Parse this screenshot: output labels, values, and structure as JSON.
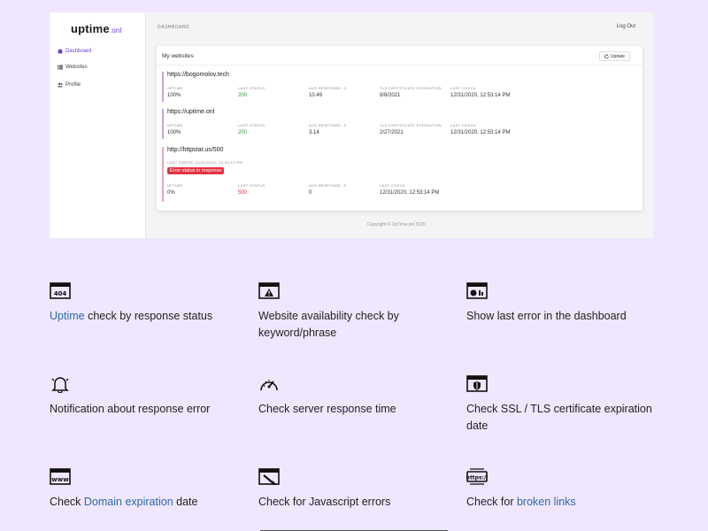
{
  "app": {
    "logo_main": "uptime",
    "logo_tld": ".onl",
    "sidebar": [
      {
        "label": "Dashboard",
        "icon": "dashboard-icon",
        "active": true
      },
      {
        "label": "Websites",
        "icon": "list-icon",
        "active": false
      },
      {
        "label": "Profile",
        "icon": "users-icon",
        "active": false
      }
    ],
    "breadcrumb": "DASHBOARD",
    "logout": "Log Out",
    "card_title": "My websites",
    "update_label": "Update",
    "sites": [
      {
        "url": "https://bogomolov.tech",
        "metrics": [
          {
            "label": "UPTIME",
            "value": "100%"
          },
          {
            "label": "LAST STATUS",
            "value": "200"
          },
          {
            "label": "AVG RESPONSE, S",
            "value": "10.49"
          },
          {
            "label": "TLS CERTIFICATE EXPIRATION",
            "value": "8/8/2021"
          },
          {
            "label": "LAST CHECK",
            "value": "12/31/2020, 12:53:14 PM"
          }
        ]
      },
      {
        "url": "https://uptime.onl",
        "metrics": [
          {
            "label": "UPTIME",
            "value": "100%"
          },
          {
            "label": "LAST STATUS",
            "value": "200"
          },
          {
            "label": "AVG RESPONSE, S",
            "value": "3.14"
          },
          {
            "label": "TLS CERTIFICATE EXPIRATION",
            "value": "2/27/2021"
          },
          {
            "label": "LAST CHECK",
            "value": "12/31/2020, 12:53:14 PM"
          }
        ]
      },
      {
        "url": "http://httpstat.us/500",
        "last_error_label": "LAST ERROR 12/31/2020, 12:53:14 PM",
        "error_badge": "Error status in response",
        "metrics": [
          {
            "label": "UPTIME",
            "value": "0%"
          },
          {
            "label": "LAST STATUS",
            "value": "500"
          },
          {
            "label": "AVG RESPONSE, S",
            "value": "0"
          },
          {
            "label": "LAST CHECK",
            "value": "12/31/2020, 12:53:14 PM"
          }
        ]
      }
    ],
    "copyright": "Copyright © UpTime.onl 2020"
  },
  "features": [
    {
      "icon": "404-browser-icon",
      "link": "Uptime",
      "text_after": " check by response status"
    },
    {
      "icon": "warning-browser-icon",
      "text": "Website availability check by keyword/phrase"
    },
    {
      "icon": "dashboard-browser-icon",
      "text": "Show last error in the dashboard"
    },
    {
      "icon": "bell-icon",
      "text": "Notification about response error"
    },
    {
      "icon": "speedometer-icon",
      "text": "Check server response time"
    },
    {
      "icon": "shield-browser-icon",
      "text": "Check SSL / TLS certificate expiration date"
    },
    {
      "icon": "www-browser-icon",
      "text_before": "Check ",
      "link": "Domain expiration",
      "text_after": " date"
    },
    {
      "icon": "js-error-browser-icon",
      "text": "Check for Javascript errors"
    },
    {
      "icon": "https-link-icon",
      "text_before": "Check for ",
      "link": "broken links"
    }
  ],
  "colors": {
    "background": "#f0e6fd",
    "link": "#2a6aa8",
    "accent": "#6a3fd4",
    "ok_status": "#2e9a36",
    "error_status": "#e02a3b"
  }
}
